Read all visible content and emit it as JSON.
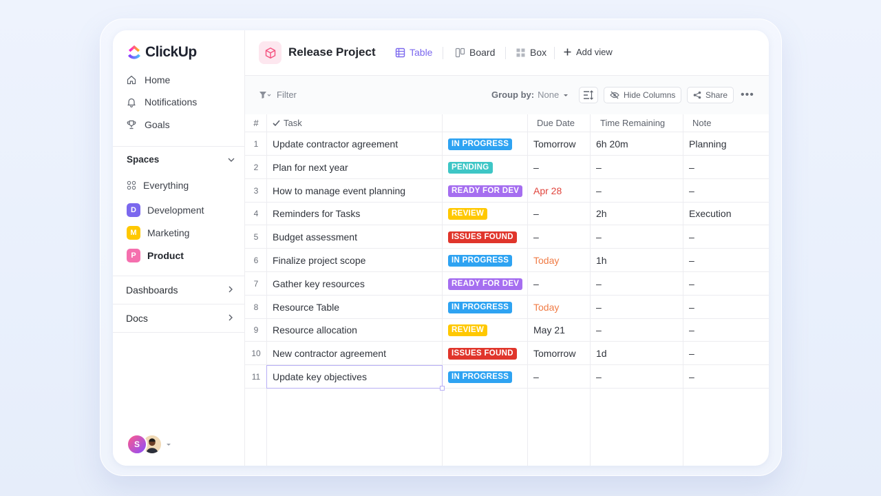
{
  "app": {
    "name": "ClickUp"
  },
  "sidebar": {
    "nav": [
      {
        "label": "Home",
        "icon": "home-icon"
      },
      {
        "label": "Notifications",
        "icon": "bell-icon"
      },
      {
        "label": "Goals",
        "icon": "trophy-icon"
      }
    ],
    "spaces_label": "Spaces",
    "everything_label": "Everything",
    "spaces": [
      {
        "letter": "D",
        "label": "Development",
        "color": "#7b68ee"
      },
      {
        "letter": "M",
        "label": "Marketing",
        "color": "#ffc800"
      },
      {
        "letter": "P",
        "label": "Product",
        "color": "#f56fae"
      }
    ],
    "dashboards_label": "Dashboards",
    "docs_label": "Docs",
    "user_initial": "S"
  },
  "header": {
    "project_title": "Release Project",
    "views": [
      {
        "label": "Table",
        "icon": "table-icon",
        "active": true
      },
      {
        "label": "Board",
        "icon": "board-icon",
        "active": false
      },
      {
        "label": "Box",
        "icon": "box-grid-icon",
        "active": false
      }
    ],
    "add_view_label": "Add view"
  },
  "toolbar": {
    "filter_label": "Filter",
    "group_by_label": "Group by:",
    "group_by_value": "None",
    "hide_columns_label": "Hide Columns",
    "share_label": "Share"
  },
  "table": {
    "columns": [
      "#",
      "Task",
      "",
      "Due Date",
      "Time Remaining",
      "Note"
    ],
    "rows": [
      {
        "num": "1",
        "task": "Update contractor agreement",
        "status": "IN PROGRESS",
        "status_color": "#2ea3f2",
        "due": "Tomorrow",
        "due_color": "#2f333b",
        "time": "6h 20m",
        "note": "Planning"
      },
      {
        "num": "2",
        "task": "Plan for next year",
        "status": "PENDING",
        "status_color": "#3ec6c6",
        "due": "–",
        "due_color": "#2f333b",
        "time": "–",
        "note": "–"
      },
      {
        "num": "3",
        "task": "How to manage event planning",
        "status": "READY FOR DEV",
        "status_color": "#a56ef0",
        "due": "Apr 28",
        "due_color": "#e0443c",
        "time": "–",
        "note": "–"
      },
      {
        "num": "4",
        "task": "Reminders for Tasks",
        "status": "REVIEW",
        "status_color": "#ffc800",
        "due": "–",
        "due_color": "#2f333b",
        "time": "2h",
        "note": "Execution"
      },
      {
        "num": "5",
        "task": "Budget assessment",
        "status": "ISSUES FOUND",
        "status_color": "#e0352b",
        "due": "–",
        "due_color": "#2f333b",
        "time": "–",
        "note": "–"
      },
      {
        "num": "6",
        "task": "Finalize project scope",
        "status": "IN PROGRESS",
        "status_color": "#2ea3f2",
        "due": "Today",
        "due_color": "#f07b45",
        "time": "1h",
        "note": "–"
      },
      {
        "num": "7",
        "task": "Gather key resources",
        "status": "READY FOR DEV",
        "status_color": "#a56ef0",
        "due": "–",
        "due_color": "#2f333b",
        "time": "–",
        "note": "–"
      },
      {
        "num": "8",
        "task": "Resource Table",
        "status": "IN PROGRESS",
        "status_color": "#2ea3f2",
        "due": "Today",
        "due_color": "#f07b45",
        "time": "–",
        "note": "–"
      },
      {
        "num": "9",
        "task": "Resource allocation",
        "status": "REVIEW",
        "status_color": "#ffc800",
        "due": "May 21",
        "due_color": "#2f333b",
        "time": "–",
        "note": "–"
      },
      {
        "num": "10",
        "task": "New contractor agreement",
        "status": "ISSUES FOUND",
        "status_color": "#e0352b",
        "due": "Tomorrow",
        "due_color": "#2f333b",
        "time": "1d",
        "note": "–"
      },
      {
        "num": "11",
        "task": "Update key objectives",
        "status": "IN PROGRESS",
        "status_color": "#2ea3f2",
        "due": "–",
        "due_color": "#2f333b",
        "time": "–",
        "note": "–"
      }
    ]
  }
}
